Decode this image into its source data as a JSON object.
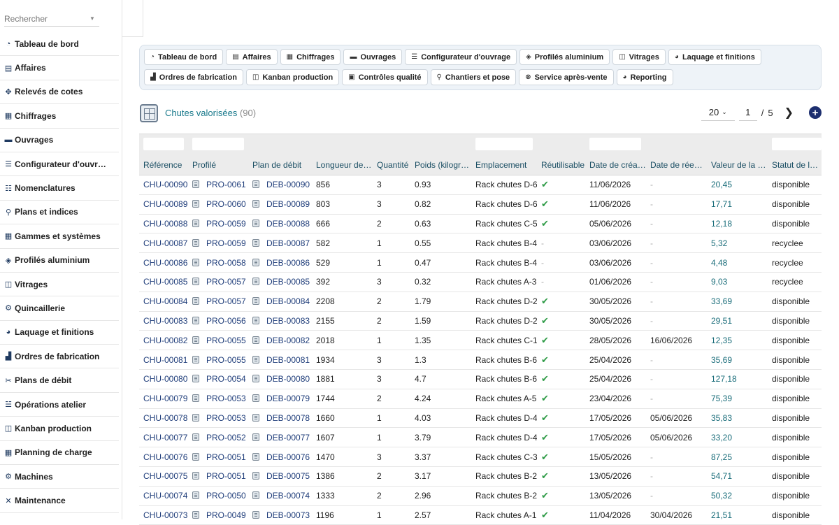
{
  "search": {
    "placeholder": "Rechercher"
  },
  "sidebar": {
    "items": [
      {
        "label": "Tableau de bord",
        "icon": "gauge-icon",
        "glyph": "◔"
      },
      {
        "label": "Affaires",
        "icon": "briefcase-icon",
        "glyph": "▤"
      },
      {
        "label": "Relevés de cotes",
        "icon": "move-icon",
        "glyph": "✥"
      },
      {
        "label": "Chiffrages",
        "icon": "calculator-icon",
        "glyph": "▦"
      },
      {
        "label": "Ouvrages",
        "icon": "window-icon",
        "glyph": "▬"
      },
      {
        "label": "Configurateur d'ouvr…",
        "icon": "sliders-icon",
        "glyph": "☰"
      },
      {
        "label": "Nomenclatures",
        "icon": "list-icon",
        "glyph": "☷"
      },
      {
        "label": "Plans et indices",
        "icon": "pen-icon",
        "glyph": "⚲"
      },
      {
        "label": "Gammes et systèmes",
        "icon": "grid-icon",
        "glyph": "▦"
      },
      {
        "label": "Profilés aluminium",
        "icon": "layers-icon",
        "glyph": "◈"
      },
      {
        "label": "Vitrages",
        "icon": "panel-icon",
        "glyph": "◫"
      },
      {
        "label": "Quincaillerie",
        "icon": "gears-icon",
        "glyph": "⚙"
      },
      {
        "label": "Laquage et finitions",
        "icon": "palette-icon",
        "glyph": "◕"
      },
      {
        "label": "Ordres de fabrication",
        "icon": "factory-icon",
        "glyph": "▟"
      },
      {
        "label": "Plans de débit",
        "icon": "scissors-icon",
        "glyph": "✂"
      },
      {
        "label": "Opérations atelier",
        "icon": "tasks-icon",
        "glyph": "☱"
      },
      {
        "label": "Kanban production",
        "icon": "kanban-icon",
        "glyph": "◫"
      },
      {
        "label": "Planning de charge",
        "icon": "calendar-icon",
        "glyph": "▦"
      },
      {
        "label": "Machines",
        "icon": "cogs-icon",
        "glyph": "⚙"
      },
      {
        "label": "Maintenance",
        "icon": "tools-icon",
        "glyph": "✕"
      }
    ]
  },
  "quick_links": [
    {
      "label": "Tableau de bord",
      "icon": "gauge-icon",
      "glyph": "◔"
    },
    {
      "label": "Affaires",
      "icon": "briefcase-icon",
      "glyph": "▤"
    },
    {
      "label": "Chiffrages",
      "icon": "calculator-icon",
      "glyph": "▦"
    },
    {
      "label": "Ouvrages",
      "icon": "window-icon",
      "glyph": "▬"
    },
    {
      "label": "Configurateur d'ouvrage",
      "icon": "sliders-icon",
      "glyph": "☰"
    },
    {
      "label": "Profilés aluminium",
      "icon": "layers-icon",
      "glyph": "◈"
    },
    {
      "label": "Vitrages",
      "icon": "panel-icon",
      "glyph": "◫"
    },
    {
      "label": "Laquage et finitions",
      "icon": "palette-icon",
      "glyph": "◕"
    },
    {
      "label": "Ordres de fabrication",
      "icon": "factory-icon",
      "glyph": "▟"
    },
    {
      "label": "Kanban production",
      "icon": "kanban-icon",
      "glyph": "◫"
    },
    {
      "label": "Contrôles qualité",
      "icon": "clipboard-icon",
      "glyph": "▣"
    },
    {
      "label": "Chantiers et pose",
      "icon": "map-pin-icon",
      "glyph": "⚲"
    },
    {
      "label": "Service après-vente",
      "icon": "lifebuoy-icon",
      "glyph": "⊗"
    },
    {
      "label": "Reporting",
      "icon": "pie-chart-icon",
      "glyph": "◕"
    }
  ],
  "list": {
    "title": "Chutes valorisées",
    "count": "(90)",
    "page_size": "20",
    "page": "1",
    "page_sep": "/",
    "page_total": "5"
  },
  "columns": [
    "Référence",
    "Profilé",
    "Plan de débit",
    "Longueur de…",
    "Quantité",
    "Poids (kilogr…",
    "Emplacement",
    "Réutilisable",
    "Date de créa…",
    "Date de rée…",
    "Valeur de la …",
    "Statut de la …"
  ],
  "rows": [
    {
      "ref": "CHU-00090",
      "prof": "PRO-0061",
      "plan": "DEB-00090",
      "len": "856",
      "qty": "3",
      "poids": "0.93",
      "empl": "Rack chutes D-6",
      "reut": true,
      "dcre": "11/06/2026",
      "dree": "-",
      "val": "20,45",
      "stat": "disponible"
    },
    {
      "ref": "CHU-00089",
      "prof": "PRO-0060",
      "plan": "DEB-00089",
      "len": "803",
      "qty": "3",
      "poids": "0.82",
      "empl": "Rack chutes D-6",
      "reut": true,
      "dcre": "11/06/2026",
      "dree": "-",
      "val": "17,71",
      "stat": "disponible"
    },
    {
      "ref": "CHU-00088",
      "prof": "PRO-0059",
      "plan": "DEB-00088",
      "len": "666",
      "qty": "2",
      "poids": "0.63",
      "empl": "Rack chutes C-5",
      "reut": true,
      "dcre": "05/06/2026",
      "dree": "-",
      "val": "12,18",
      "stat": "disponible"
    },
    {
      "ref": "CHU-00087",
      "prof": "PRO-0059",
      "plan": "DEB-00087",
      "len": "582",
      "qty": "1",
      "poids": "0.55",
      "empl": "Rack chutes B-4",
      "reut": false,
      "dcre": "03/06/2026",
      "dree": "-",
      "val": "5,32",
      "stat": "recyclee"
    },
    {
      "ref": "CHU-00086",
      "prof": "PRO-0058",
      "plan": "DEB-00086",
      "len": "529",
      "qty": "1",
      "poids": "0.47",
      "empl": "Rack chutes B-4",
      "reut": false,
      "dcre": "03/06/2026",
      "dree": "-",
      "val": "4,48",
      "stat": "recyclee"
    },
    {
      "ref": "CHU-00085",
      "prof": "PRO-0057",
      "plan": "DEB-00085",
      "len": "392",
      "qty": "3",
      "poids": "0.32",
      "empl": "Rack chutes A-3",
      "reut": false,
      "dcre": "01/06/2026",
      "dree": "-",
      "val": "9,03",
      "stat": "recyclee"
    },
    {
      "ref": "CHU-00084",
      "prof": "PRO-0057",
      "plan": "DEB-00084",
      "len": "2208",
      "qty": "2",
      "poids": "1.79",
      "empl": "Rack chutes D-2",
      "reut": true,
      "dcre": "30/05/2026",
      "dree": "-",
      "val": "33,69",
      "stat": "disponible"
    },
    {
      "ref": "CHU-00083",
      "prof": "PRO-0056",
      "plan": "DEB-00083",
      "len": "2155",
      "qty": "2",
      "poids": "1.59",
      "empl": "Rack chutes D-2",
      "reut": true,
      "dcre": "30/05/2026",
      "dree": "-",
      "val": "29,51",
      "stat": "disponible"
    },
    {
      "ref": "CHU-00082",
      "prof": "PRO-0055",
      "plan": "DEB-00082",
      "len": "2018",
      "qty": "1",
      "poids": "1.35",
      "empl": "Rack chutes C-1",
      "reut": true,
      "dcre": "28/05/2026",
      "dree": "16/06/2026",
      "val": "12,35",
      "stat": "disponible"
    },
    {
      "ref": "CHU-00081",
      "prof": "PRO-0055",
      "plan": "DEB-00081",
      "len": "1934",
      "qty": "3",
      "poids": "1.3",
      "empl": "Rack chutes B-6",
      "reut": true,
      "dcre": "25/04/2026",
      "dree": "-",
      "val": "35,69",
      "stat": "disponible"
    },
    {
      "ref": "CHU-00080",
      "prof": "PRO-0054",
      "plan": "DEB-00080",
      "len": "1881",
      "qty": "3",
      "poids": "4.7",
      "empl": "Rack chutes B-6",
      "reut": true,
      "dcre": "25/04/2026",
      "dree": "-",
      "val": "127,18",
      "stat": "disponible"
    },
    {
      "ref": "CHU-00079",
      "prof": "PRO-0053",
      "plan": "DEB-00079",
      "len": "1744",
      "qty": "2",
      "poids": "4.24",
      "empl": "Rack chutes A-5",
      "reut": true,
      "dcre": "23/04/2026",
      "dree": "-",
      "val": "75,39",
      "stat": "disponible"
    },
    {
      "ref": "CHU-00078",
      "prof": "PRO-0053",
      "plan": "DEB-00078",
      "len": "1660",
      "qty": "1",
      "poids": "4.03",
      "empl": "Rack chutes D-4",
      "reut": true,
      "dcre": "17/05/2026",
      "dree": "05/06/2026",
      "val": "35,83",
      "stat": "disponible"
    },
    {
      "ref": "CHU-00077",
      "prof": "PRO-0052",
      "plan": "DEB-00077",
      "len": "1607",
      "qty": "1",
      "poids": "3.79",
      "empl": "Rack chutes D-4",
      "reut": true,
      "dcre": "17/05/2026",
      "dree": "05/06/2026",
      "val": "33,20",
      "stat": "disponible"
    },
    {
      "ref": "CHU-00076",
      "prof": "PRO-0051",
      "plan": "DEB-00076",
      "len": "1470",
      "qty": "3",
      "poids": "3.37",
      "empl": "Rack chutes C-3",
      "reut": true,
      "dcre": "15/05/2026",
      "dree": "-",
      "val": "87,25",
      "stat": "disponible"
    },
    {
      "ref": "CHU-00075",
      "prof": "PRO-0051",
      "plan": "DEB-00075",
      "len": "1386",
      "qty": "2",
      "poids": "3.17",
      "empl": "Rack chutes B-2",
      "reut": true,
      "dcre": "13/05/2026",
      "dree": "-",
      "val": "54,71",
      "stat": "disponible"
    },
    {
      "ref": "CHU-00074",
      "prof": "PRO-0050",
      "plan": "DEB-00074",
      "len": "1333",
      "qty": "2",
      "poids": "2.96",
      "empl": "Rack chutes B-2",
      "reut": true,
      "dcre": "13/05/2026",
      "dree": "-",
      "val": "50,32",
      "stat": "disponible"
    },
    {
      "ref": "CHU-00073",
      "prof": "PRO-0049",
      "plan": "DEB-00073",
      "len": "1196",
      "qty": "1",
      "poids": "2.57",
      "empl": "Rack chutes A-1",
      "reut": true,
      "dcre": "11/04/2026",
      "dree": "30/04/2026",
      "val": "21,51",
      "stat": "disponible"
    }
  ],
  "glyphs": {
    "check": "✔",
    "dash": "-",
    "next": "❯",
    "add": "+",
    "chevron": "⌄",
    "caret": "▼"
  }
}
